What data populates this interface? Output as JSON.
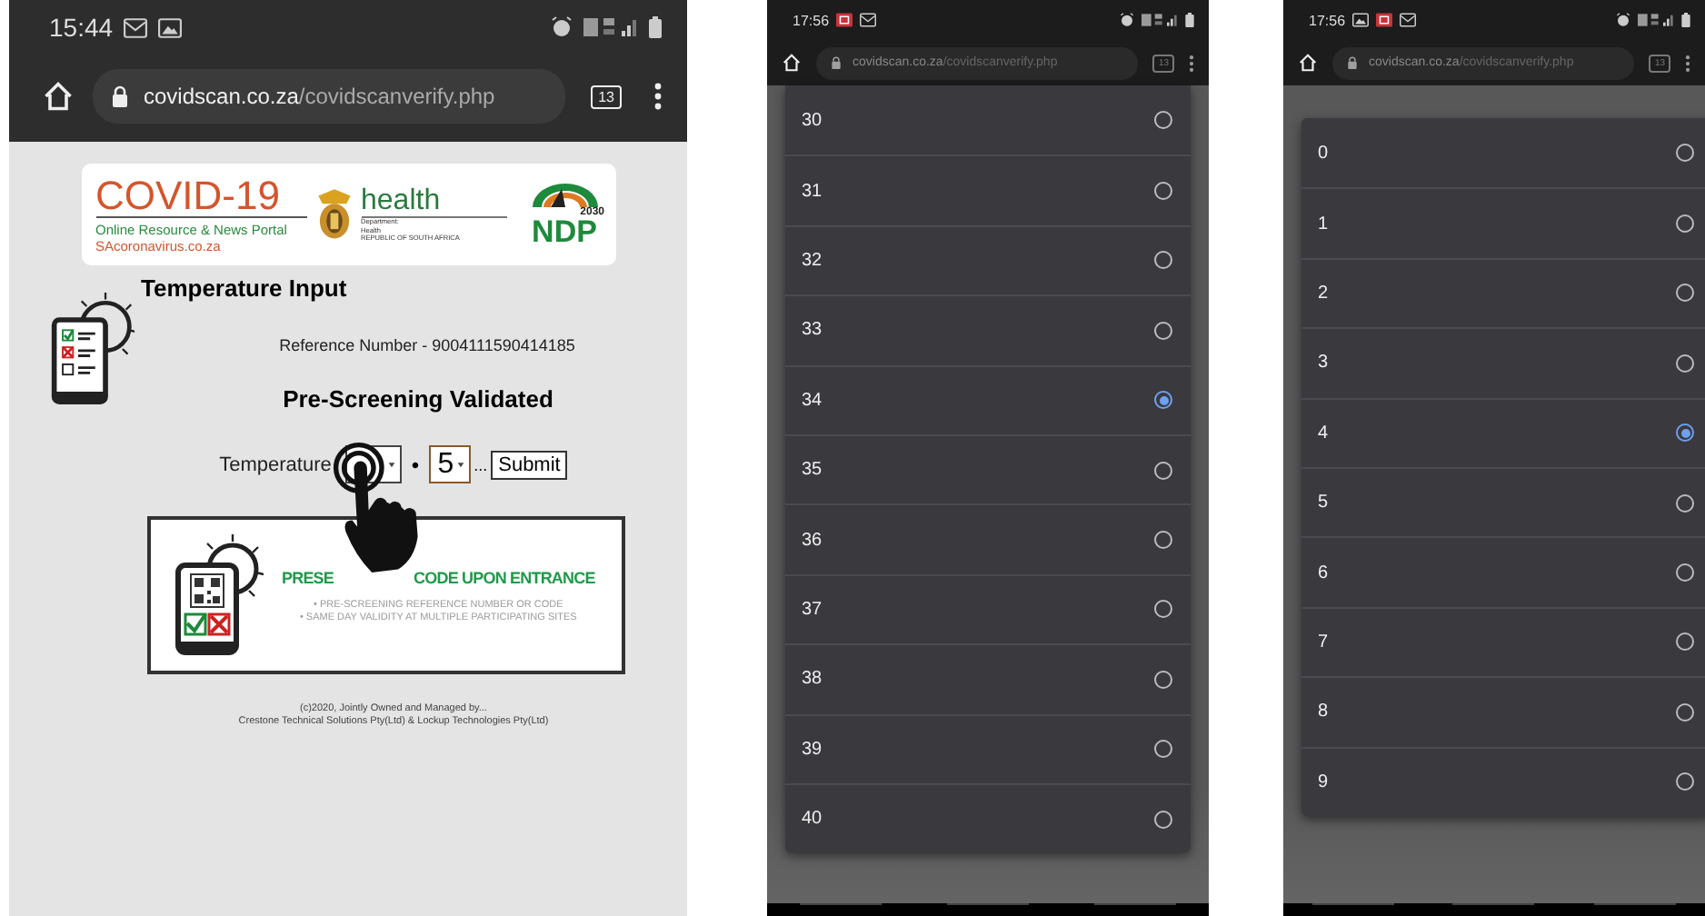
{
  "phones": [
    {
      "kind": "page",
      "status_bar": {
        "time": "15:44"
      },
      "address_bar": {
        "domain": "covidscan.co.za",
        "path": "/covidscanverify.php",
        "tab_count": "13"
      },
      "logo": {
        "title": "COVID-19",
        "subtitle": "Online Resource & News Portal",
        "site": "SAcoronavirus.co.za",
        "dept_name": "health",
        "dept_lines": [
          "Department:",
          "Health",
          "REPUBLIC OF SOUTH AFRICA"
        ],
        "ndp_year": "2030",
        "ndp": "NDP"
      },
      "heading": "Temperature Input",
      "reference": "Reference Number - 9004111590414185",
      "status": "Pre-Screening Validated",
      "temperature": {
        "label": "Temperature",
        "separator": "•",
        "decimal_value": "5",
        "ellipsis": "...",
        "submit": "Submit"
      },
      "banner": {
        "headline_parts": [
          "PRESE",
          "CODE UPON ENTRANCE"
        ],
        "bullets": [
          "• PRE-SCREENING REFERENCE NUMBER OR CODE",
          "• SAME DAY VALIDITY AT MULTIPLE PARTICIPATING SITES"
        ]
      },
      "footer": [
        "(c)2020, Jointly Owned and Managed by...",
        "Crestone Technical Solutions Pty(Ltd) & Lockup Technologies Pty(Ltd)"
      ]
    },
    {
      "kind": "picker",
      "status_bar": {
        "time": "17:56"
      },
      "address_bar": {
        "domain": "covidscan.co.za",
        "path": "/covidscanverify.php",
        "tab_count": "13"
      },
      "options": [
        {
          "label": "30",
          "selected": false
        },
        {
          "label": "31",
          "selected": false
        },
        {
          "label": "32",
          "selected": false
        },
        {
          "label": "33",
          "selected": false
        },
        {
          "label": "34",
          "selected": true
        },
        {
          "label": "35",
          "selected": false
        },
        {
          "label": "36",
          "selected": false
        },
        {
          "label": "37",
          "selected": false
        },
        {
          "label": "38",
          "selected": false
        },
        {
          "label": "39",
          "selected": false
        },
        {
          "label": "40",
          "selected": false
        }
      ]
    },
    {
      "kind": "picker",
      "status_bar": {
        "time": "17:56"
      },
      "address_bar": {
        "domain": "covidscan.co.za",
        "path": "/covidscanverify.php",
        "tab_count": "13"
      },
      "options": [
        {
          "label": "0",
          "selected": false
        },
        {
          "label": "1",
          "selected": false
        },
        {
          "label": "2",
          "selected": false
        },
        {
          "label": "3",
          "selected": false
        },
        {
          "label": "4",
          "selected": true
        },
        {
          "label": "5",
          "selected": false
        },
        {
          "label": "6",
          "selected": false
        },
        {
          "label": "7",
          "selected": false
        },
        {
          "label": "8",
          "selected": false
        },
        {
          "label": "9",
          "selected": false
        }
      ]
    }
  ]
}
